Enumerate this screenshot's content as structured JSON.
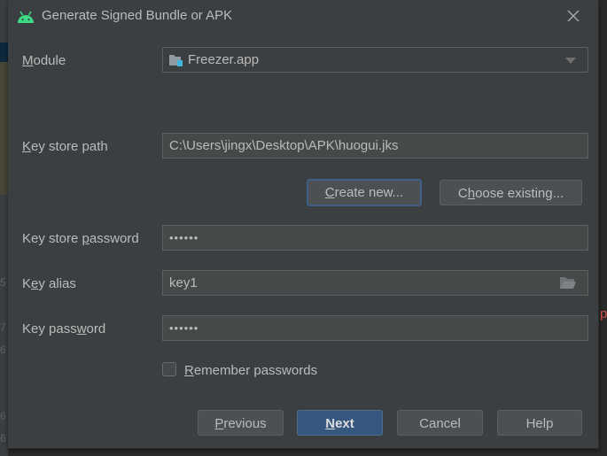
{
  "background": {
    "line_numbers": [
      "5",
      "7",
      "6",
      "6",
      "6"
    ],
    "right_fragment": "p"
  },
  "dialog": {
    "title": "Generate Signed Bundle or APK",
    "icons": {
      "app": "android-icon",
      "close": "close-icon",
      "module": "module-folder-icon",
      "dropdown": "chevron-down-icon",
      "browse": "folder-open-icon"
    },
    "module": {
      "label": {
        "pre": "",
        "key": "M",
        "post": "odule"
      },
      "value": "Freezer.app"
    },
    "key_store_path": {
      "label": {
        "pre": "",
        "key": "K",
        "post": "ey store path"
      },
      "value": "C:\\Users\\jingx\\Desktop\\APK\\huogui.jks"
    },
    "create_new": {
      "pre": "",
      "key": "C",
      "post": "reate new..."
    },
    "choose_existing": {
      "pre": "C",
      "key": "h",
      "post": "oose existing..."
    },
    "key_store_password": {
      "label": {
        "pre": "Key store ",
        "key": "p",
        "post": "assword"
      },
      "value": "••••••"
    },
    "key_alias": {
      "label": {
        "pre": "K",
        "key": "e",
        "post": "y alias"
      },
      "value": "key1"
    },
    "key_password": {
      "label": {
        "pre": "Key pass",
        "key": "w",
        "post": "ord"
      },
      "value": "••••••"
    },
    "remember": {
      "label": {
        "pre": "",
        "key": "R",
        "post": "emember passwords"
      },
      "checked": false
    },
    "buttons": {
      "previous": {
        "pre": "",
        "key": "P",
        "post": "revious"
      },
      "next": {
        "pre": "",
        "key": "N",
        "post": "ext"
      },
      "cancel": "Cancel",
      "help": "Help"
    },
    "colors": {
      "accent": "#365880",
      "android": "#3ddc84",
      "background": "#3c3f41"
    }
  }
}
